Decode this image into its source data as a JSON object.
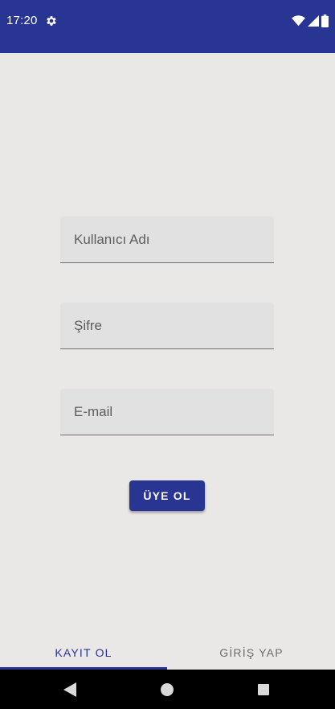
{
  "status_bar": {
    "time": "17:20",
    "icons": [
      "gear-icon",
      "wifi-icon",
      "cell-signal-icon",
      "battery-icon"
    ],
    "background": "#283593"
  },
  "form": {
    "username_placeholder": "Kullanıcı Adı",
    "password_placeholder": "Şifre",
    "email_placeholder": "E-mail",
    "register_button": "ÜYE OL"
  },
  "tabs": [
    {
      "label": "KAYIT OL",
      "selected": true
    },
    {
      "label": "GİRİŞ YAP",
      "selected": false
    }
  ],
  "nav_bar": {
    "icons": [
      "back-icon",
      "home-icon",
      "recents-icon"
    ]
  },
  "colors": {
    "accent": "#283593",
    "background": "#eae8e6",
    "field_background": "#e1e1e1"
  }
}
